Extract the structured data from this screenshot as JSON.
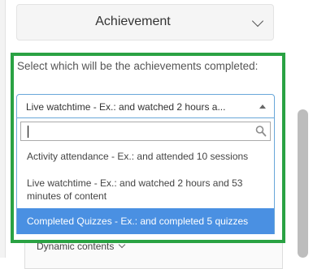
{
  "achievement_header": {
    "title": "Achievement"
  },
  "achievement_form": {
    "prompt": "Select which will be the achievements completed:",
    "selected_value": "Live watchtime - Ex.: and watched 2 hours a...",
    "search_value": "",
    "options": [
      {
        "label": "Activity attendance - Ex.: and attended 10 sessions",
        "highlighted": false
      },
      {
        "label": "Live watchtime - Ex.: and watched 2 hours and 53 minutes of content",
        "highlighted": false
      },
      {
        "label": "Completed Quizzes - Ex.: and completed 5 quizzes",
        "highlighted": true
      }
    ]
  },
  "background_section": {
    "label": "Dynamic contents"
  },
  "colors": {
    "highlight": "#4a90e2",
    "frame": "#2aa243",
    "select_border": "#69a7d9"
  },
  "icons": {
    "header_toggle": "chevron-down-icon",
    "select_toggle": "triangle-up-icon",
    "search": "search-icon"
  }
}
